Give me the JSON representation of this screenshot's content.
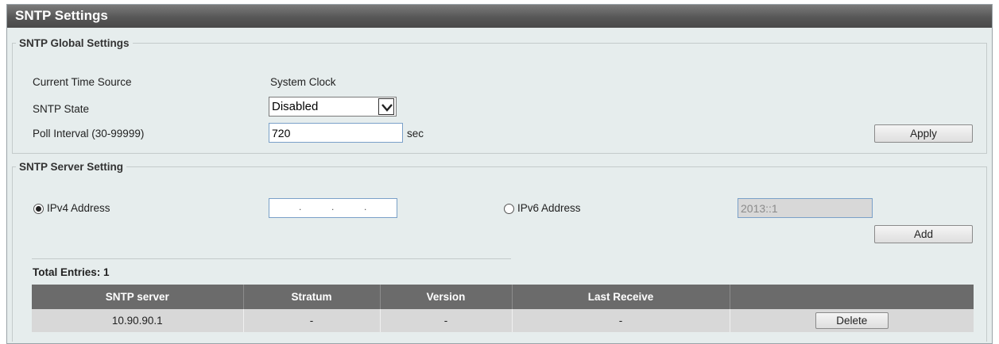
{
  "page": {
    "title": "SNTP Settings"
  },
  "global": {
    "legend": "SNTP Global Settings",
    "time_source_label": "Current Time Source",
    "time_source_value": "System Clock",
    "state_label": "SNTP State",
    "state_value": "Disabled",
    "state_options": [
      "Disabled"
    ],
    "poll_label": "Poll Interval (30-99999)",
    "poll_value": "720",
    "poll_unit": "sec",
    "apply_label": "Apply"
  },
  "server": {
    "legend": "SNTP Server Setting",
    "ipv4_label": "IPv4 Address",
    "ipv4_selected": true,
    "ipv6_label": "IPv6 Address",
    "ipv6_value": "2013::1",
    "add_label": "Add",
    "total_entries": "Total Entries: 1",
    "columns": [
      "SNTP server",
      "Stratum",
      "Version",
      "Last Receive",
      ""
    ],
    "rows": [
      {
        "server": "10.90.90.1",
        "stratum": "-",
        "version": "-",
        "last_receive": "-",
        "action": "Delete"
      }
    ]
  }
}
